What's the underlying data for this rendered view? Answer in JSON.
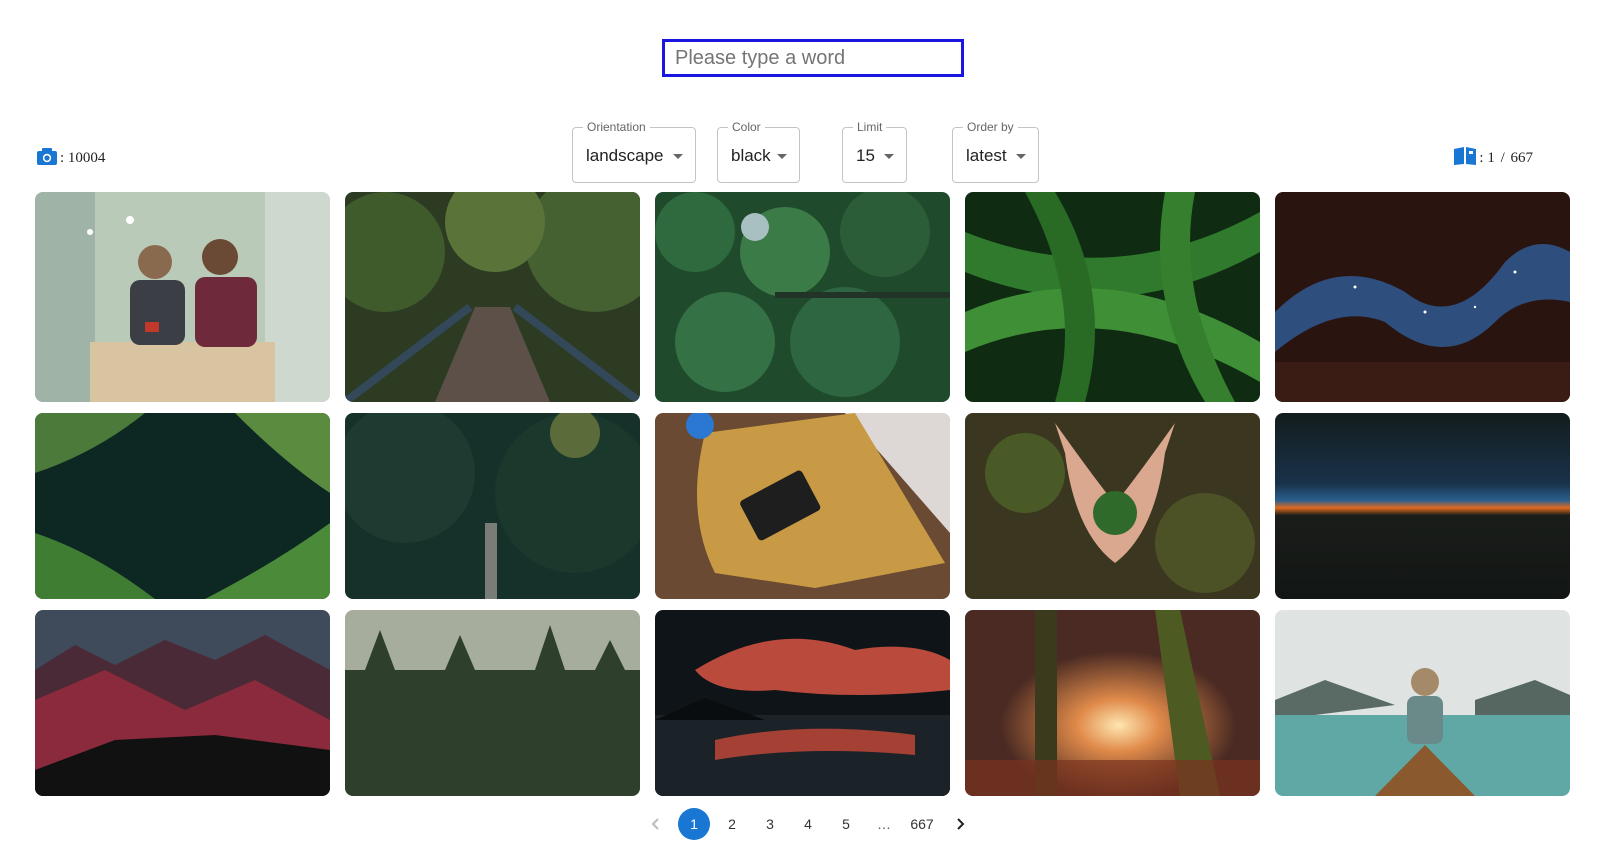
{
  "search": {
    "placeholder": "Please type a word",
    "value": ""
  },
  "stats": {
    "total_icon": "camera-icon",
    "total_count": ": 10004",
    "pages_icon": "book-icon",
    "pages_current": ": 1",
    "pages_sep": " / ",
    "pages_total": "667"
  },
  "filters": [
    {
      "label": "Orientation",
      "value": "landscape"
    },
    {
      "label": "Color",
      "value": "black"
    },
    {
      "label": "Limit",
      "value": "15"
    },
    {
      "label": "Order by",
      "value": "latest"
    }
  ],
  "photos": [
    "couple-in-camper-van",
    "wooden-bridge-in-forest",
    "aerial-pine-forest",
    "green-fern-leaves",
    "starry-sky-through-canyon",
    "ferns-framing-dark-sky",
    "suspension-bridge-forest",
    "ssd-on-yellow-case",
    "hands-holding-fern",
    "horizon-at-dusk",
    "red-mountain-range",
    "misty-pine-forest",
    "fiery-clouds-over-lake",
    "sunlit-autumn-forest-path",
    "woman-in-canoe-on-lake"
  ],
  "pagination": {
    "prev_icon": "chevron-left-icon",
    "next_icon": "chevron-right-icon",
    "pages": [
      "1",
      "2",
      "3",
      "4",
      "5",
      "…",
      "667"
    ],
    "current": "1"
  },
  "colors": {
    "accent": "#1976d2",
    "search_border": "#1a16e0"
  }
}
